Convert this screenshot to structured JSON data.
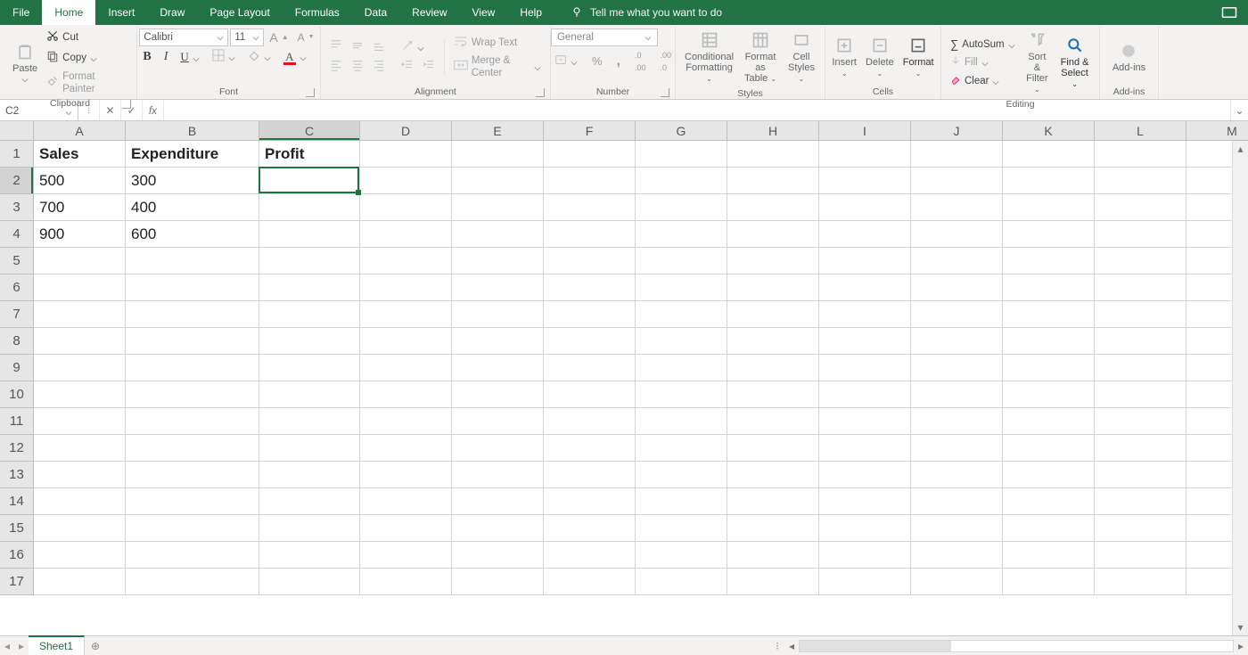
{
  "tabs": {
    "file": "File",
    "home": "Home",
    "insert": "Insert",
    "draw": "Draw",
    "page_layout": "Page Layout",
    "формulas": "Formulas",
    "data": "Data",
    "review": "Review",
    "view": "View",
    "help": "Help"
  },
  "tell_me": "Tell me what you want to do",
  "ribbon": {
    "paste": "Paste",
    "cut": "Cut",
    "copy": "Copy",
    "format_painter": "Format Painter",
    "clipboard_label": "Clipboard",
    "font_name": "Calibri",
    "font_size": "11",
    "bold": "B",
    "italic": "I",
    "underline": "U",
    "font_label": "Font",
    "wrap_text": "Wrap Text",
    "merge_center": "Merge & Center",
    "alignment_label": "Alignment",
    "number_format": "General",
    "number_label": "Number",
    "cond_fmt": "Conditional Formatting",
    "fmt_table": "Format as Table",
    "cell_styles": "Cell Styles",
    "styles_label": "Styles",
    "insert": "Insert",
    "delete": "Delete",
    "format": "Format",
    "cells_label": "Cells",
    "autosum": "AutoSum",
    "fill": "Fill",
    "clear": "Clear",
    "sort_filter": "Sort & Filter",
    "find_select": "Find & Select",
    "editing_label": "Editing",
    "addins": "Add-ins",
    "addins_label": "Add-ins"
  },
  "name_box": "C2",
  "formula_value": "",
  "columns": [
    "A",
    "B",
    "C",
    "D",
    "E",
    "F",
    "G",
    "H",
    "I",
    "J",
    "K",
    "L",
    "M"
  ],
  "rows": [
    "1",
    "2",
    "3",
    "4",
    "5",
    "6",
    "7",
    "8",
    "9",
    "10",
    "11",
    "12",
    "13",
    "14",
    "15",
    "16",
    "17"
  ],
  "sheet_data": {
    "A1": "Sales",
    "B1": "Expenditure",
    "C1": "Profit",
    "A2": "500",
    "B2": "300",
    "A3": "700",
    "B3": "400",
    "A4": "900",
    "B4": "600"
  },
  "active_cell": "C2",
  "sheet_tab": "Sheet1"
}
